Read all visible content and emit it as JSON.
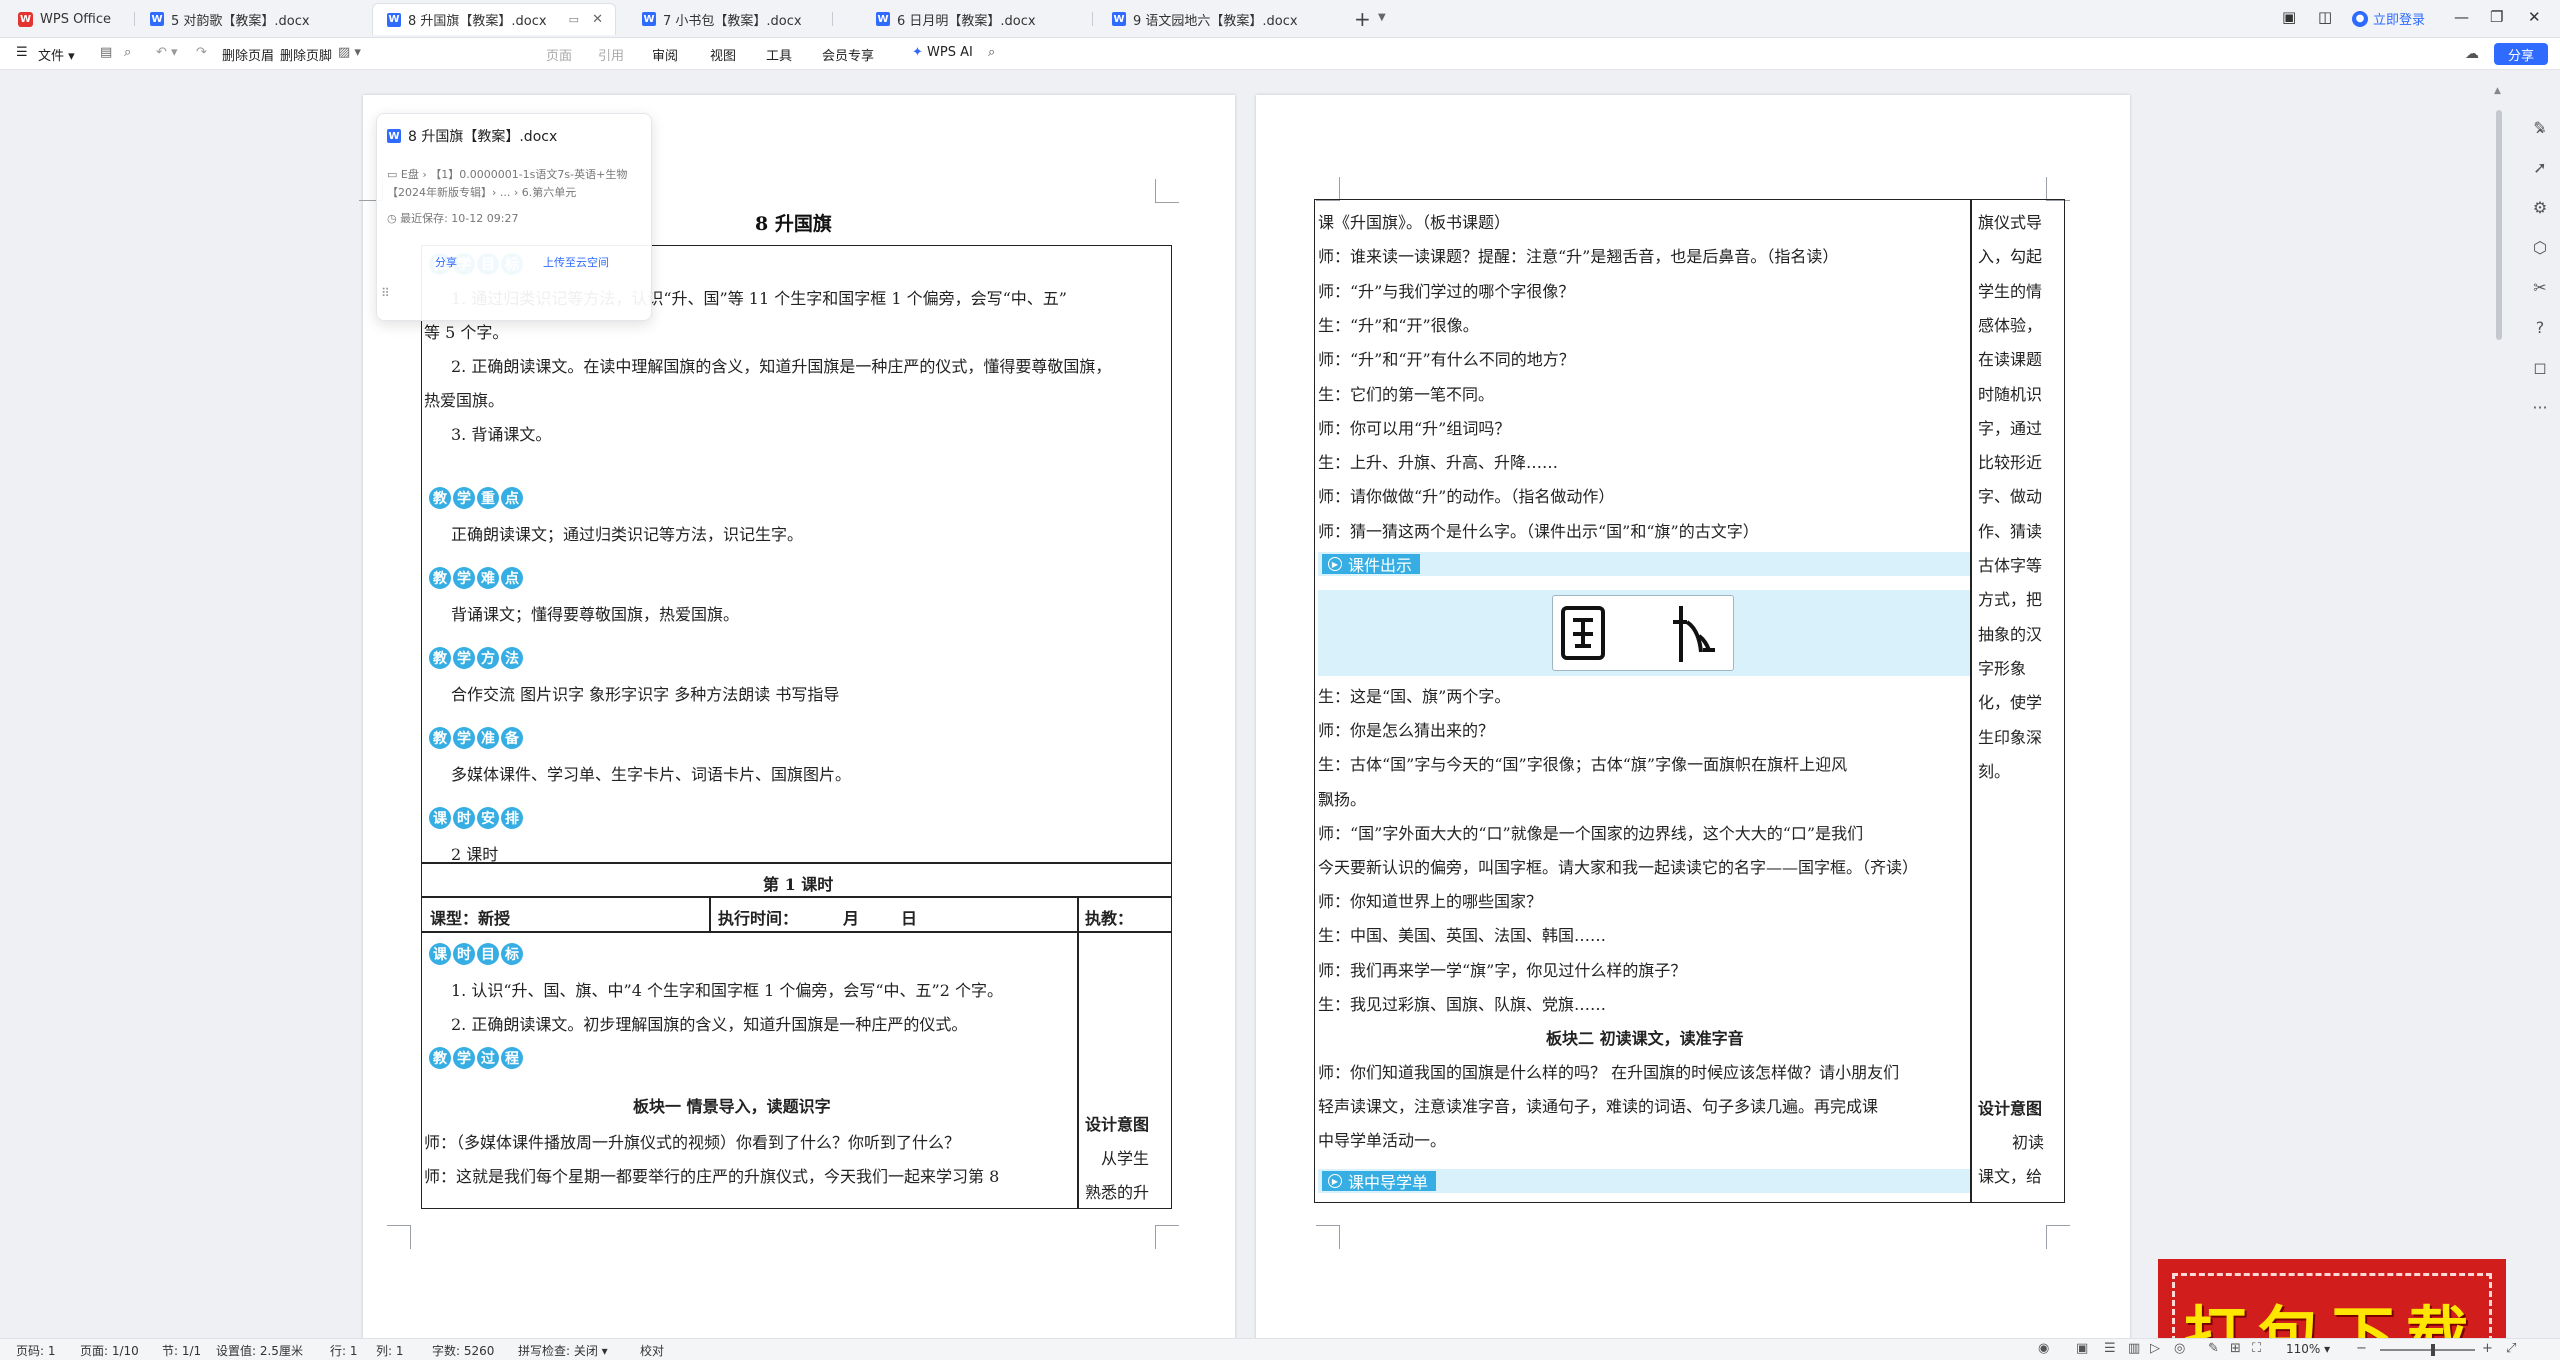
{
  "tabs": [
    {
      "label": "WPS Office",
      "kind": "home"
    },
    {
      "label": "5 对韵歌【教案】.docx",
      "kind": "doc"
    },
    {
      "label": "8 升国旗【教案】.docx",
      "kind": "doc",
      "active": true
    },
    {
      "label": "7 小书包【教案】.docx",
      "kind": "doc"
    },
    {
      "label": "6 日月明【教案】.docx",
      "kind": "doc"
    },
    {
      "label": "9 语文园地六【教案】.docx",
      "kind": "doc"
    }
  ],
  "titlebar": {
    "login": "立即登录"
  },
  "toolbar": {
    "items": [
      "文件",
      "删除页眉",
      "删除页脚",
      "审阅",
      "视图",
      "工具",
      "会员专享",
      "WPS AI"
    ],
    "hidden_items": [
      "页面",
      "引用"
    ],
    "share": "分享"
  },
  "popup": {
    "title": "8 升国旗【教案】.docx",
    "path": "E盘 › 【1】0.0000001-1s语文7s-英语+生物【2024年新版专辑】› ... › 6.第六单元",
    "saved": "最近保存: 10-12 09:27",
    "share": "分享",
    "upload": "上传至云空间"
  },
  "page1": {
    "title": "8  升国旗",
    "sections": [
      {
        "badge": [
          "教",
          "学",
          "目",
          "标"
        ],
        "lines": [
          "1. 通过归类识记等方法，认识“升、国”等 11 个生字和国字框 1 个偏旁，会写“中、五”",
          "等 5 个字。",
          "2. 正确朗读课文。在读中理解国旗的含义，知道升国旗是一种庄严的仪式，懂得要尊敬国旗，",
          "热爱国旗。",
          "3. 背诵课文。"
        ]
      },
      {
        "badge": [
          "教",
          "学",
          "重",
          "点"
        ],
        "lines": [
          "正确朗读课文；通过归类识记等方法，识记生字。"
        ]
      },
      {
        "badge": [
          "教",
          "学",
          "难",
          "点"
        ],
        "lines": [
          "背诵课文；懂得要尊敬国旗，热爱国旗。"
        ]
      },
      {
        "badge": [
          "教",
          "学",
          "方",
          "法"
        ],
        "lines": [
          "合作交流    图片识字    象形字识字    多种方法朗读    书写指导"
        ]
      },
      {
        "badge": [
          "教",
          "学",
          "准",
          "备"
        ],
        "lines": [
          "多媒体课件、学习单、生字卡片、词语卡片、国旗图片。"
        ]
      },
      {
        "badge": [
          "课",
          "时",
          "安",
          "排"
        ],
        "lines": [
          "2 课时"
        ]
      }
    ],
    "lesson_title": "第 1 课时",
    "row": {
      "type": "课型：新授",
      "time": "执行时间：",
      "month": "月",
      "day": "日",
      "teacher": "执教："
    },
    "goal_badge": [
      "课",
      "时",
      "目",
      "标"
    ],
    "goal_lines": [
      "1. 认识“升、国、旗、中”4 个生字和国字框 1 个偏旁，会写“中、五”2 个字。",
      "2. 正确朗读课文。初步理解国旗的含义，知道升国旗是一种庄严的仪式。"
    ],
    "process_badge": [
      "教",
      "学",
      "过",
      "程"
    ],
    "block1": "板块一    情景导入，读题识字",
    "process_lines": [
      "师：（多媒体课件播放周一升旗仪式的视频）你看到了什么？你听到了什么？",
      "师：这就是我们每个星期一都要举行的庄严的升旗仪式，今天我们一起来学习第 8"
    ],
    "design_title": "设计意图",
    "design_lines": [
      "从学生",
      "熟悉的升"
    ]
  },
  "page2": {
    "lines_a": [
      "课《升国旗》。（板书课题）",
      "师：谁来读一读课题？提醒：注意“升”是翘舌音，也是后鼻音。（指名读）",
      "师：“升”与我们学过的哪个字很像？",
      "生：“升”和“开”很像。",
      "师：“升”和“开”有什么不同的地方？",
      "生：它们的第一笔不同。",
      "师：你可以用“升”组词吗？",
      "生：上升、升旗、升高、升降……",
      "师：请你做做“升”的动作。（指名做动作）",
      "师：猜一猜这两个是什么字。（课件出示“国”和“旗”的古文字）"
    ],
    "bar1": "课件出示",
    "glyphs": [
      "国",
      "旗"
    ],
    "lines_b": [
      "生：这是“国、旗”两个字。",
      "师：你是怎么猜出来的？",
      "生：古体“国”字与今天的“国”字很像；古体“旗”字像一面旗帜在旗杆上迎风",
      "飘扬。",
      "师：“国”字外面大大的“口”就像是一个国家的边界线，这个大大的“口”是我们",
      "今天要新认识的偏旁，叫国字框。请大家和我一起读读它的名字——国字框。（齐读）",
      "师：你知道世界上的哪些国家？",
      "生：中国、美国、英国、法国、韩国……",
      "师：我们再来学一学“旗”字，你见过什么样的旗子？",
      "生：我见过彩旗、国旗、队旗、党旗……"
    ],
    "block2": "板块二    初读课文，读准字音",
    "lines_c": [
      "师：你们知道我国的国旗是什么样的吗？  在升国旗的时候应该怎样做？请小朋友们",
      "轻声读课文，注意读准字音，读通句子，难读的词语、句子多读几遍。再完成课",
      "中导学单活动一。"
    ],
    "bar2": "课中导学单",
    "side_lines": [
      "旗仪式导",
      "入，勾起",
      "学生的情",
      "感体验，",
      "在读课题",
      "时随机识",
      "字，通过",
      "比较形近",
      "字、做动",
      "作、猜读",
      "古体字等",
      "方式，把",
      "抽象的汉",
      "字形象",
      "化，使学",
      "生印象深",
      "刻。"
    ],
    "side_design": "设计意图",
    "side_tail": [
      "初读",
      "课文，给"
    ]
  },
  "status": {
    "page": "页码: 1",
    "pages": "页面: 1/10",
    "section": "节: 1/1",
    "setting": "设置值: 2.5厘米",
    "row": "行: 1",
    "col": "列: 1",
    "words": "字数: 5260",
    "spell": "拼写检查: 关闭",
    "proof": "校对",
    "zoom": "110%"
  },
  "stamp": "打包下载",
  "colors": {
    "accent": "#2f6bff",
    "badge": "#37aee3",
    "band": "#d9f1fb",
    "stamp": "#d21d1d"
  },
  "icons": [
    "search-icon",
    "cloud-icon",
    "minimize-icon",
    "maximize-icon",
    "close-icon",
    "pen-icon",
    "cursor-icon",
    "settings-icon",
    "help-icon",
    "more-icon",
    "eye-icon",
    "globe-icon",
    "play-icon"
  ]
}
